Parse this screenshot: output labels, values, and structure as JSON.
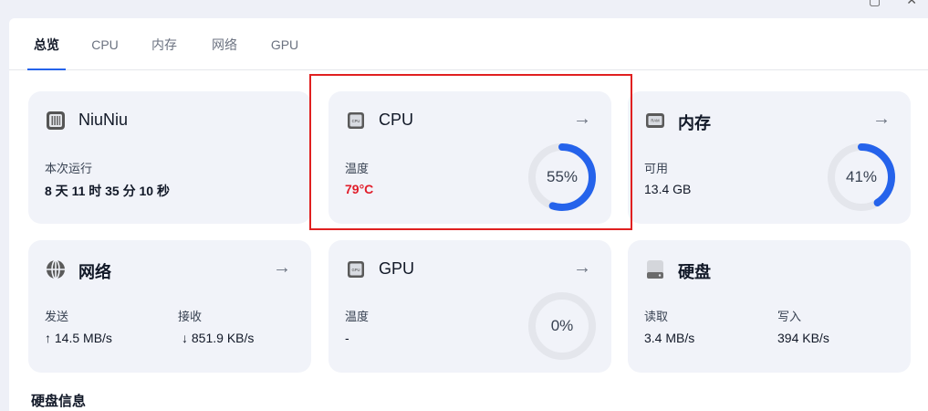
{
  "tabs": [
    {
      "label": "总览",
      "active": true
    },
    {
      "label": "CPU",
      "active": false
    },
    {
      "label": "内存",
      "active": false
    },
    {
      "label": "网络",
      "active": false
    },
    {
      "label": "GPU",
      "active": false
    }
  ],
  "cards": {
    "system": {
      "title": "NiuNiu",
      "icon": "server-icon",
      "uptime_label": "本次运行",
      "uptime_value": "8 天 11 时 35 分 10 秒"
    },
    "cpu": {
      "title": "CPU",
      "icon": "cpu-chip-icon",
      "temp_label": "温度",
      "temp_value": "79°C",
      "usage_text": "55%",
      "usage": 0.55
    },
    "memory": {
      "title": "内存",
      "icon": "ram-icon",
      "avail_label": "可用",
      "avail_value": "13.4 GB",
      "usage_text": "41%",
      "usage": 0.41
    },
    "network": {
      "title": "网络",
      "icon": "globe-icon",
      "send_label": "发送",
      "send_value": "↑ 14.5 MB/s",
      "recv_label": "接收",
      "recv_value": "↓ 851.9 KB/s"
    },
    "gpu": {
      "title": "GPU",
      "icon": "gpu-chip-icon",
      "temp_label": "温度",
      "temp_value": "-",
      "usage_text": "0%",
      "usage": 0
    },
    "disk": {
      "title": "硬盘",
      "icon": "hard-disk-icon",
      "read_label": "读取",
      "read_value": "3.4 MB/s",
      "write_label": "写入",
      "write_value": "394 KB/s"
    }
  },
  "section_title": "硬盘信息",
  "colors": {
    "accent": "#2563eb",
    "hot": "#e11d2a",
    "gauge_track": "#e4e6ec",
    "card_bg": "#f1f3f9"
  }
}
